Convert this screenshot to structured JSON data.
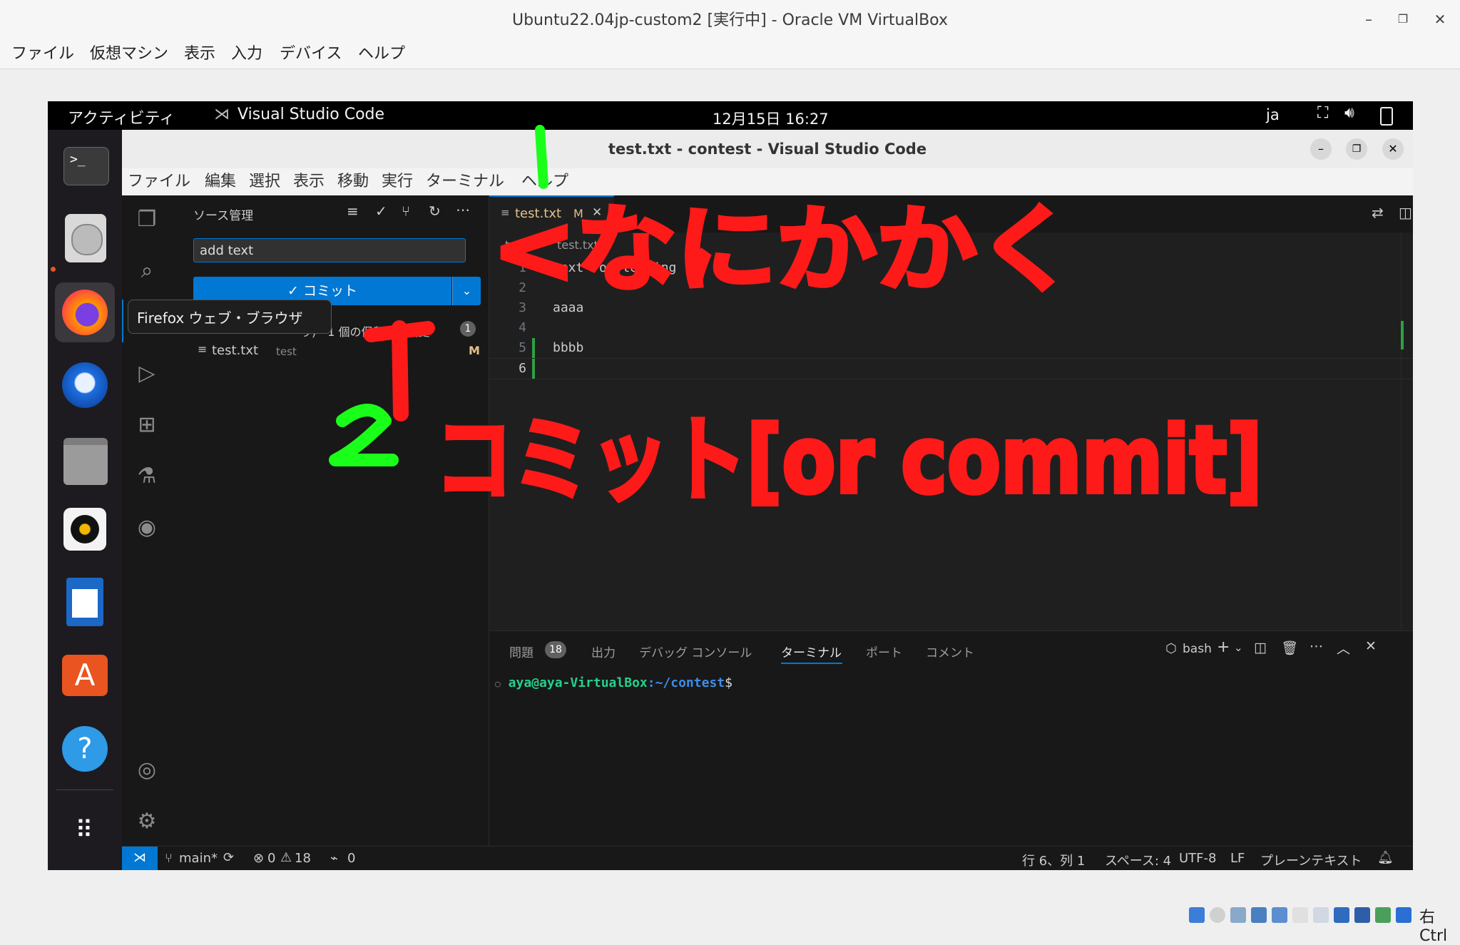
{
  "host": {
    "title": "Ubuntu22.04jp-custom2 [実行中] - Oracle VM VirtualBox",
    "menu": [
      "ファイル",
      "仮想マシン",
      "表示",
      "入力",
      "デバイス",
      "ヘルプ"
    ],
    "host_key": "右 Ctrl"
  },
  "ubuntu": {
    "activities": "アクティビティ",
    "focused_app": "Visual Studio Code",
    "clock": "12月15日  16:27",
    "input_lang": "ja",
    "dock_tooltip": "Firefox ウェブ・ブラウザ"
  },
  "vscode": {
    "window_title": "test.txt - contest - Visual Studio Code",
    "menu": [
      "ファイル",
      "編集",
      "選択",
      "表示",
      "移動",
      "実行",
      "ターミナル",
      "ヘルプ"
    ],
    "scm": {
      "title": "ソース管理",
      "commit_message": "add text",
      "commit_button": "✓ コミット",
      "changes_text": "り)・1 個の保留中の変更",
      "changes_count": "1",
      "file_name": "test.txt",
      "file_dir": "test",
      "file_status": "M"
    },
    "tab": {
      "label": "test.txt",
      "modified": "M"
    },
    "breadcrumb": {
      "folder": "test",
      "file": "test.txt"
    },
    "editor_lines": [
      {
        "num": "1",
        "text": "text for testing"
      },
      {
        "num": "2",
        "text": ""
      },
      {
        "num": "3",
        "text": "aaaa"
      },
      {
        "num": "4",
        "text": ""
      },
      {
        "num": "5",
        "text": "bbbb"
      },
      {
        "num": "6",
        "text": ""
      }
    ],
    "panel": {
      "tabs": [
        "問題",
        "出力",
        "デバッグ コンソール",
        "ターミナル",
        "ポート",
        "コメント"
      ],
      "problems_count": "18",
      "shell": "bash",
      "prompt_user": "aya@aya-VirtualBox",
      "prompt_path": ":~/contest",
      "prompt_end": "$"
    },
    "status": {
      "branch": "main*",
      "errors": "0",
      "warnings": "18",
      "ports": "0",
      "position": "行 6、列 1",
      "spaces": "スペース: 4",
      "encoding": "UTF-8",
      "eol": "LF",
      "language": "プレーンテキスト"
    }
  },
  "annotations": {
    "label_1": "1",
    "text_1": "<なにかかく",
    "label_2": "2",
    "text_2": "コミット[or commit]",
    "colors": {
      "red": "#ff1a1a",
      "green": "#1aff1a"
    }
  }
}
